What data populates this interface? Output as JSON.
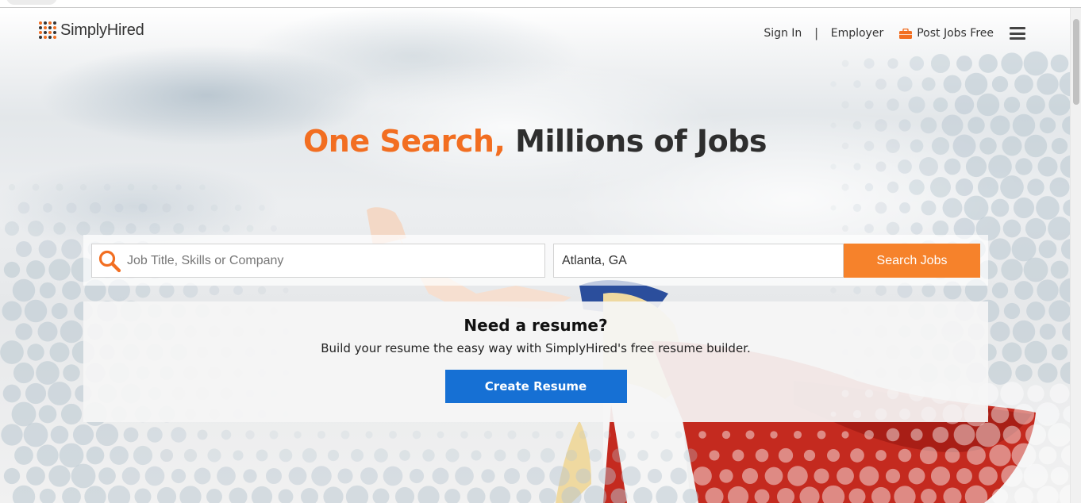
{
  "brand": {
    "name": "SimplyHired",
    "accent_color": "#f26e21",
    "logo_dot_colors": [
      "#f26e21",
      "#333333"
    ]
  },
  "nav": {
    "sign_in": "Sign In",
    "divider": "|",
    "employer": "Employer",
    "post_jobs": "Post Jobs Free",
    "post_jobs_icon": "briefcase-icon",
    "menu_icon": "hamburger-menu-icon"
  },
  "hero": {
    "headline_accent": "One Search,",
    "headline_rest": " Millions of Jobs"
  },
  "search": {
    "what_placeholder": "Job Title, Skills or Company",
    "what_value": "",
    "where_value": "Atlanta, GA",
    "button_label": "Search Jobs",
    "button_color": "#f6822b",
    "icon": "search-icon"
  },
  "resume": {
    "title": "Need a resume?",
    "subtitle": "Build your resume the easy way with SimplyHired's free resume builder.",
    "button_label": "Create Resume",
    "button_color": "#1670d4"
  }
}
